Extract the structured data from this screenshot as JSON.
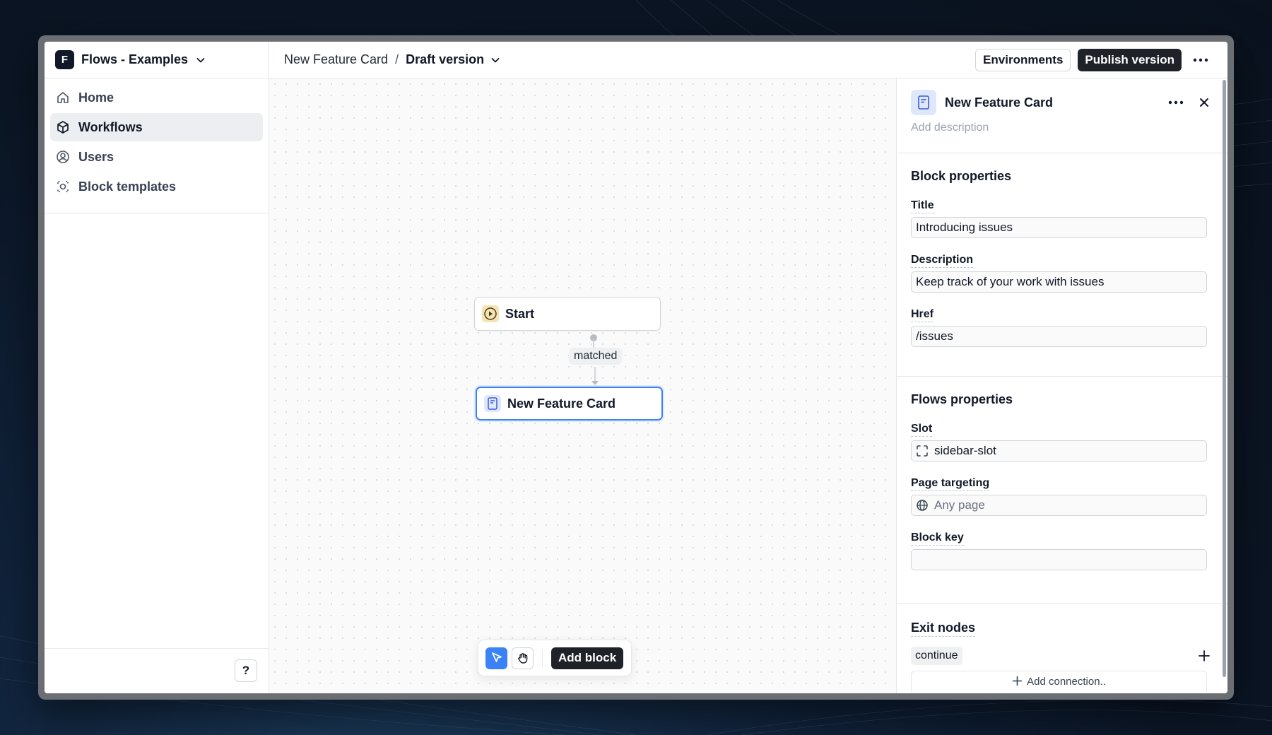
{
  "workspace": {
    "logo_letter": "F",
    "name": "Flows - Examples"
  },
  "sidebar": {
    "items": [
      {
        "label": "Home",
        "icon": "home-icon"
      },
      {
        "label": "Workflows",
        "icon": "cube-icon",
        "active": true
      },
      {
        "label": "Users",
        "icon": "user-circle-icon"
      },
      {
        "label": "Block templates",
        "icon": "block-template-icon"
      }
    ],
    "help_label": "?"
  },
  "topbar": {
    "breadcrumb_parent": "New Feature Card",
    "breadcrumb_separator": "/",
    "breadcrumb_current": "Draft version",
    "environments_label": "Environments",
    "publish_label": "Publish version"
  },
  "canvas": {
    "start_node_label": "Start",
    "edge_label": "matched",
    "feature_node_label": "New Feature Card",
    "add_block_label": "Add block"
  },
  "panel": {
    "title": "New Feature Card",
    "description_placeholder": "Add description",
    "block_properties_title": "Block properties",
    "title_label": "Title",
    "title_value": "Introducing issues",
    "description_label": "Description",
    "description_value": "Keep track of your work with issues",
    "href_label": "Href",
    "href_value": "/issues",
    "flows_properties_title": "Flows properties",
    "slot_label": "Slot",
    "slot_value": "sidebar-slot",
    "page_targeting_label": "Page targeting",
    "page_targeting_value": "Any page",
    "block_key_label": "Block key",
    "block_key_value": "",
    "exit_nodes_title": "Exit nodes",
    "exit_node": "continue",
    "add_connection_label": "Add connection.."
  },
  "colors": {
    "accent": "#3b82f6",
    "dark_button": "#1f2329",
    "start_icon_bg": "#f6e3b4",
    "card_icon_bg": "#dfe8fb"
  }
}
